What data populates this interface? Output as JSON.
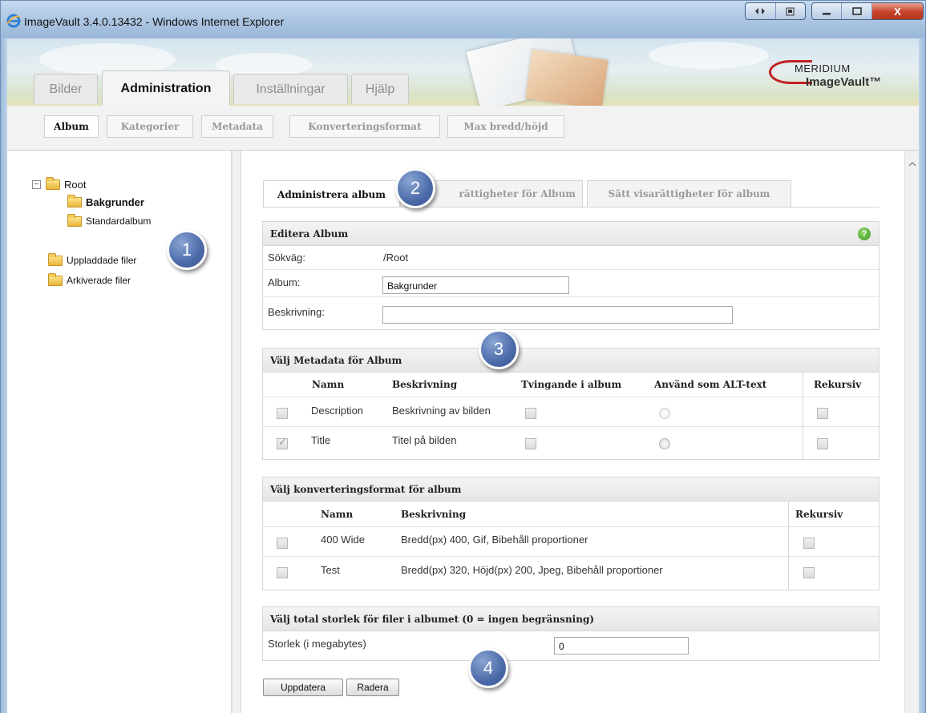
{
  "window": {
    "title": "ImageVault 3.4.0.13432 - Windows Internet Explorer",
    "controls": {
      "minimize": "minimize",
      "maximize": "maximize",
      "close": "X"
    }
  },
  "brand": {
    "line1": "MERIDIUM",
    "line2": "ImageVault™"
  },
  "main_tabs": [
    {
      "label": "Bilder",
      "active": false
    },
    {
      "label": "Administration",
      "active": true
    },
    {
      "label": "Inställningar",
      "active": false
    },
    {
      "label": "Hjälp",
      "active": false
    }
  ],
  "sub_tabs": [
    {
      "label": "Album",
      "active": true
    },
    {
      "label": "Kategorier",
      "active": false
    },
    {
      "label": "Metadata",
      "active": false
    },
    {
      "label": "Konverteringsformat",
      "active": false
    },
    {
      "label": "Max bredd/höjd",
      "active": false
    }
  ],
  "tree": {
    "root": "Root",
    "expander": "−",
    "children": [
      "Bakgrunder",
      "Standardalbum"
    ],
    "selected": "Bakgrunder",
    "special": [
      "Uppladdade filer",
      "Arkiverade filer"
    ]
  },
  "content_tabs": [
    {
      "label": "Administrera album",
      "active": true
    },
    {
      "label": "rättigheter för Album",
      "active": false
    },
    {
      "label": "Sätt visarättigheter för album",
      "active": false
    }
  ],
  "edit_album": {
    "header": "Editera Album",
    "help": "?",
    "path_label": "Sökväg:",
    "path_value": "/Root",
    "album_label": "Album:",
    "album_value": "Bakgrunder",
    "desc_label": "Beskrivning:",
    "desc_value": ""
  },
  "metadata": {
    "header": "Välj Metadata för Album",
    "columns": [
      "Namn",
      "Beskrivning",
      "Tvingande i album",
      "Använd som ALT-text",
      "Rekursiv"
    ],
    "rows": [
      {
        "name": "Description",
        "desc": "Beskrivning av bilden",
        "checked": false
      },
      {
        "name": "Title",
        "desc": "Titel på bilden",
        "checked": true
      }
    ]
  },
  "conversion": {
    "header": "Välj konverteringsformat för album",
    "columns": [
      "Namn",
      "Beskrivning",
      "Rekursiv"
    ],
    "rows": [
      {
        "name": "400 Wide",
        "desc": "Bredd(px) 400, Gif, Bibehåll proportioner"
      },
      {
        "name": "Test",
        "desc": "Bredd(px) 320, Höjd(px) 200, Jpeg, Bibehåll proportioner"
      }
    ]
  },
  "size": {
    "header": "Välj total storlek för filer i albumet (0 = ingen begränsning)",
    "label": "Storlek (i megabytes)",
    "value": "0"
  },
  "buttons": {
    "update": "Uppdatera",
    "delete": "Radera"
  },
  "callouts": [
    "1",
    "2",
    "3",
    "4"
  ]
}
